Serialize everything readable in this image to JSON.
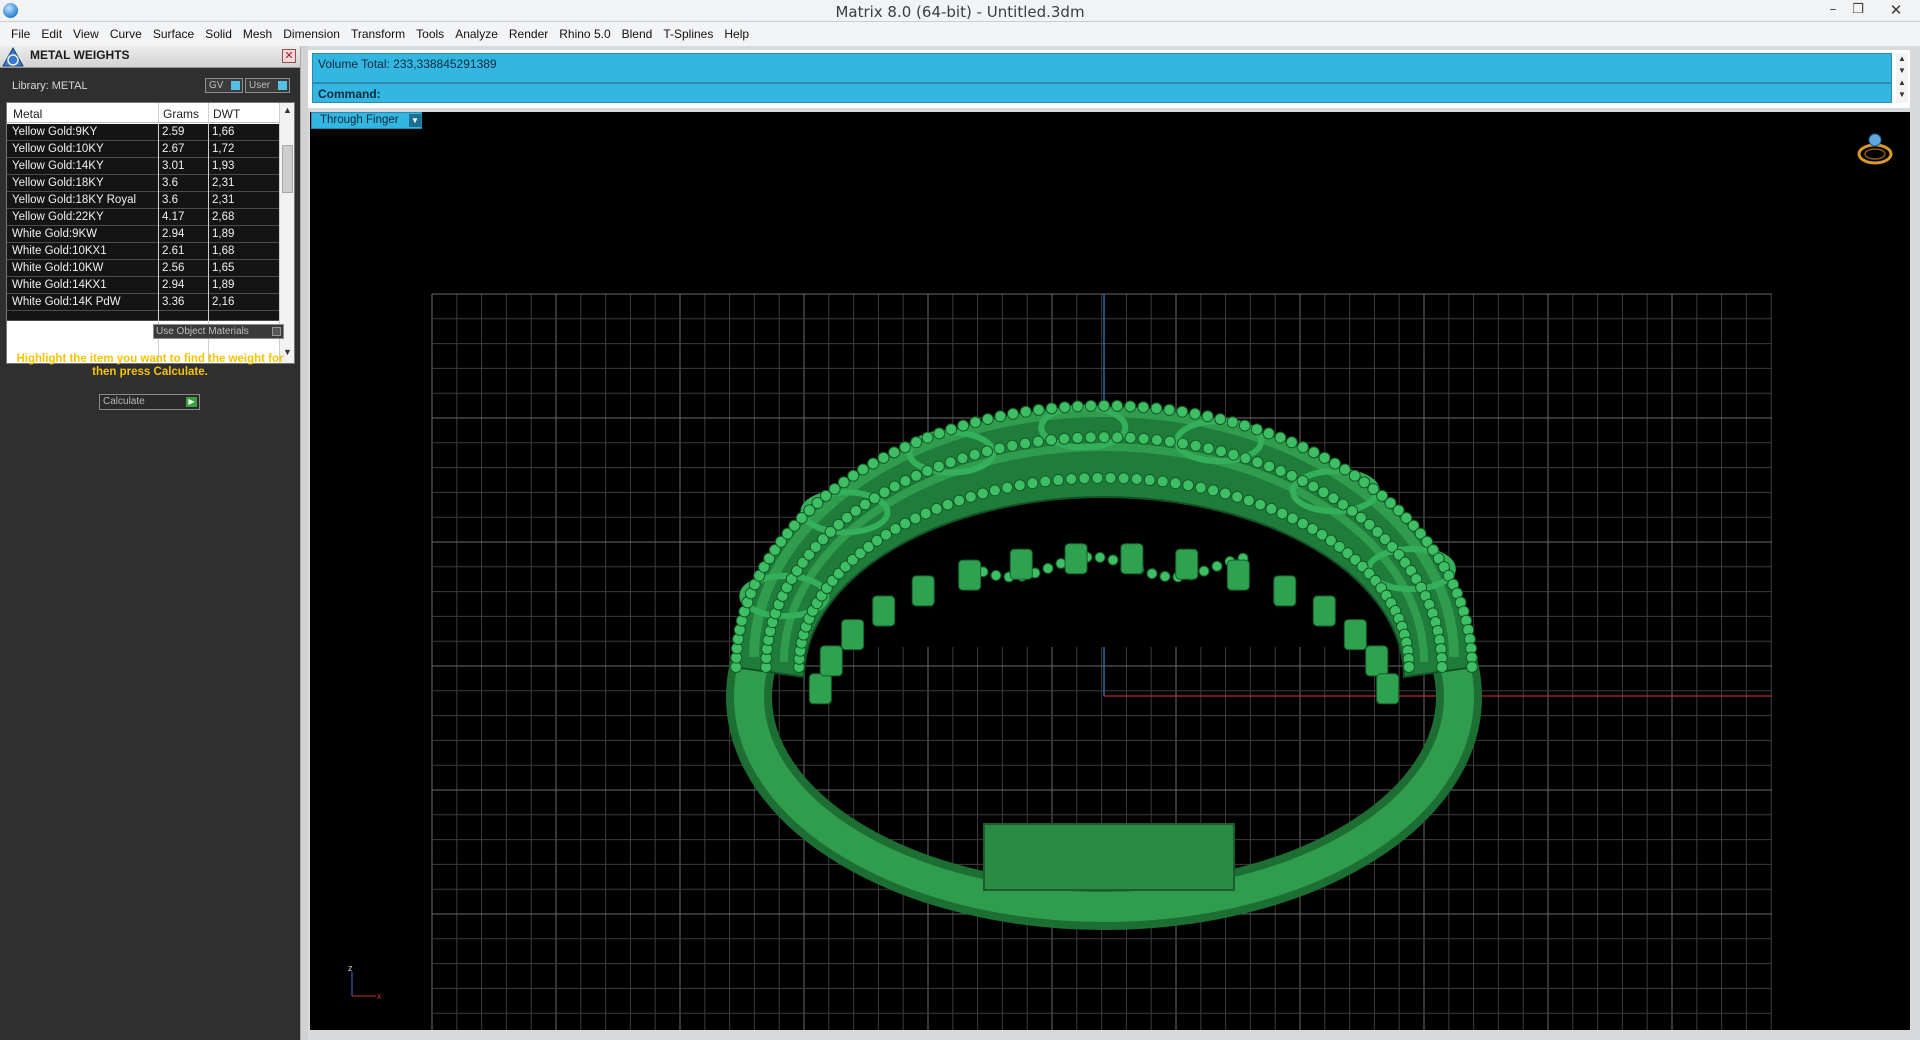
{
  "window": {
    "title": "Matrix 8.0 (64-bit) - Untitled.3dm",
    "min": "–",
    "max": "❐",
    "close": "✕"
  },
  "menu": [
    "File",
    "Edit",
    "View",
    "Curve",
    "Surface",
    "Solid",
    "Mesh",
    "Dimension",
    "Transform",
    "Tools",
    "Analyze",
    "Render",
    "Rhino 5.0",
    "Blend",
    "T-Splines",
    "Help"
  ],
  "panel": {
    "title": "METAL WEIGHTS",
    "library": "Library: METAL",
    "gv": "GV",
    "user": "User",
    "columns": {
      "metal": "Metal",
      "grams": "Grams",
      "dwt": "DWT"
    },
    "rows": [
      {
        "metal": "Yellow Gold:9KY",
        "grams": "2.59",
        "dwt": "1,66"
      },
      {
        "metal": "Yellow Gold:10KY",
        "grams": "2.67",
        "dwt": "1,72"
      },
      {
        "metal": "Yellow Gold:14KY",
        "grams": "3.01",
        "dwt": "1,93"
      },
      {
        "metal": "Yellow Gold:18KY",
        "grams": "3.6",
        "dwt": "2,31"
      },
      {
        "metal": "Yellow Gold:18KY Royal",
        "grams": "3.6",
        "dwt": "2,31"
      },
      {
        "metal": "Yellow Gold:22KY",
        "grams": "4.17",
        "dwt": "2,68"
      },
      {
        "metal": "White Gold:9KW",
        "grams": "2.94",
        "dwt": "1,89"
      },
      {
        "metal": "White Gold:10KX1",
        "grams": "2.61",
        "dwt": "1,68"
      },
      {
        "metal": "White Gold:10KW",
        "grams": "2.56",
        "dwt": "1,65"
      },
      {
        "metal": "White Gold:14KX1",
        "grams": "2.94",
        "dwt": "1,89"
      },
      {
        "metal": "White Gold:14K PdW",
        "grams": "3.36",
        "dwt": "2,16"
      }
    ],
    "use_object_materials": "Use Object Materials",
    "hint": "Highlight the item you want to find the weight for then press Calculate.",
    "calculate": "Calculate"
  },
  "command": {
    "volume": "Volume Total: 233,338845291389",
    "prompt": "Command:"
  },
  "viewport": {
    "view_name": "Through Finger",
    "model_color": "#2f9d4d",
    "axis_x_label": "x",
    "axis_z_label": "z"
  },
  "icons": {
    "app": "matrix-app-icon",
    "ring": "ring-icon",
    "axes": "axes-icon"
  }
}
